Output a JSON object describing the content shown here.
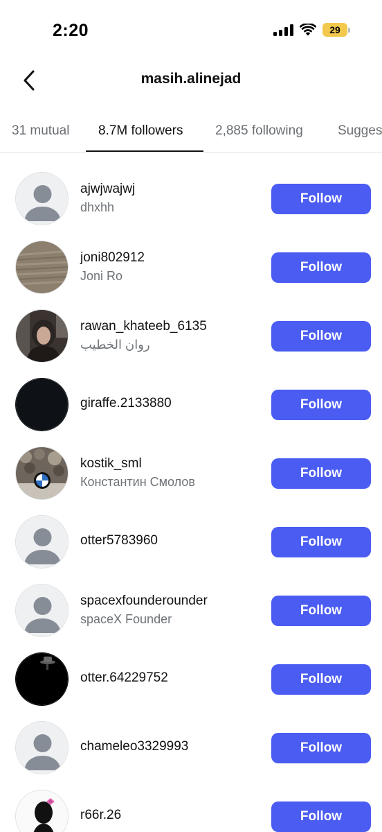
{
  "status_bar": {
    "time": "2:20",
    "battery": "29"
  },
  "header": {
    "title": "masih.alinejad"
  },
  "tabs": [
    {
      "label": "31 mutual",
      "active": false
    },
    {
      "label": "8.7M followers",
      "active": true
    },
    {
      "label": "2,885 following",
      "active": false
    },
    {
      "label": "Sugges",
      "active": false
    }
  ],
  "colors": {
    "accent": "#4a5cf2",
    "battery": "#f2c94c"
  },
  "followers": [
    {
      "username": "ajwjwajwj",
      "fullname": "dhxhh",
      "avatar": "default-avatar-icon",
      "button": "Follow"
    },
    {
      "username": "joni802912",
      "fullname": "Joni  Ro",
      "avatar": "texture-photo",
      "button": "Follow"
    },
    {
      "username": "rawan_khateeb_6135",
      "fullname": "روان الخطيب",
      "avatar": "person-photo",
      "button": "Follow"
    },
    {
      "username": "giraffe.2133880",
      "fullname": "",
      "avatar": "dark-photo",
      "button": "Follow"
    },
    {
      "username": "kostik_sml",
      "fullname": "Константин Смолов",
      "avatar": "car-logo-photo",
      "button": "Follow"
    },
    {
      "username": "otter5783960",
      "fullname": "",
      "avatar": "default-avatar-icon",
      "button": "Follow"
    },
    {
      "username": "spacexfounderounder",
      "fullname": "spaceX Founder",
      "avatar": "default-avatar-icon",
      "button": "Follow"
    },
    {
      "username": "otter.64229752",
      "fullname": "",
      "avatar": "black-hat-photo",
      "button": "Follow"
    },
    {
      "username": "chameleo3329993",
      "fullname": "",
      "avatar": "default-avatar-icon",
      "button": "Follow"
    },
    {
      "username": "r66r.26",
      "fullname": "",
      "avatar": "silhouette-photo",
      "button": "Follow"
    }
  ]
}
